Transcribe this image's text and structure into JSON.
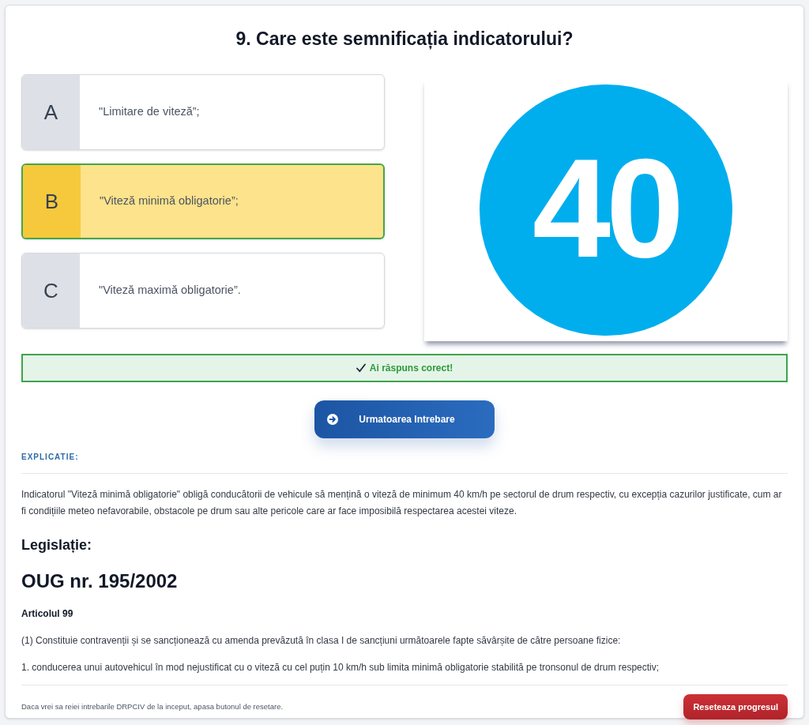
{
  "question": {
    "title": "9. Care este semnificația indicatorului?"
  },
  "answers": [
    {
      "letter": "A",
      "text": "\"Limitare de viteză”;",
      "selected": false
    },
    {
      "letter": "B",
      "text": "\"Viteză minimă obligatorie”;",
      "selected": true
    },
    {
      "letter": "C",
      "text": "\"Viteză maximă obligatorie”.",
      "selected": false
    }
  ],
  "sign": {
    "number": "40"
  },
  "feedback": {
    "text": "Ai răspuns corect!",
    "correct": true
  },
  "next_button": {
    "label": "Urmatoarea Intrebare"
  },
  "explanation": {
    "heading": "EXPLICATIE:",
    "text": "Indicatorul \"Viteză minimă obligatorie\" obligă conducătorii de vehicule să mențină o viteză de minimum 40 km/h pe sectorul de drum respectiv, cu excepția cazurilor justificate, cum ar fi condițiile meteo nefavorabile, obstacole pe drum sau alte pericole care ar face imposibilă respectarea acestei viteze."
  },
  "legislation": {
    "heading": "Legislație:",
    "act": "OUG nr. 195/2002",
    "article": "Articolul 99",
    "paragraphs": [
      "(1) Constituie contravenții și se sancționează cu amenda prevăzută în clasa I de sancțiuni următoarele fapte săvârșite de către persoane fizice:",
      "1. conducerea unui autovehicul în mod nejustificat cu o viteză cu cel puțin 10 km/h sub limita minimă obligatorie stabilită pe tronsonul de drum respectiv;"
    ]
  },
  "footer": {
    "note": "Daca vrei sa reiei intrebarile DRPCIV de la inceput, apasa butonul de resetare.",
    "reset_button": "Reseteaza progresul"
  }
}
